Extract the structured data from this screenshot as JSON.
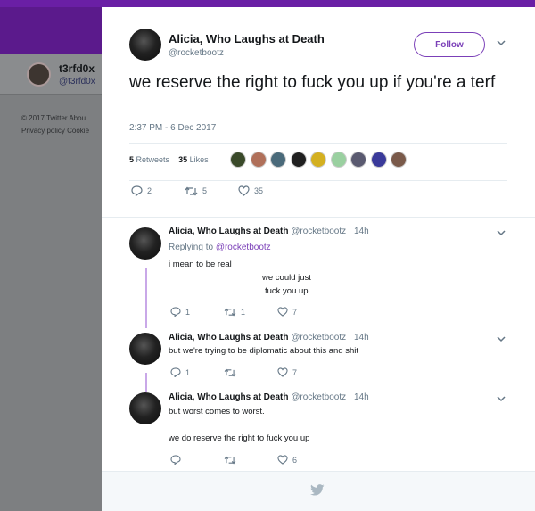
{
  "background": {
    "profile": {
      "name": "t3rfd0x",
      "handle": "@t3rfd0x"
    },
    "footer": {
      "line1": "© 2017 Twitter  Abou",
      "line2": "Privacy policy  Cookie"
    }
  },
  "tweet": {
    "author_name": "Alicia, Who Laughs at Death",
    "author_handle": "@rocketbootz",
    "follow_label": "Follow",
    "text": "we reserve the right to fuck you up if you're a terf",
    "timestamp": "2:37 PM - 6 Dec 2017",
    "retweets_count": "5",
    "retweets_label": "Retweets",
    "likes_count": "35",
    "likes_label": "Likes",
    "actions": {
      "replies": "2",
      "retweets": "5",
      "likes": "35"
    }
  },
  "replies": [
    {
      "name": "Alicia, Who Laughs at Death",
      "handle_time": "@rocketbootz · 14h",
      "replying_prefix": "Replying to",
      "replying_to": "@rocketbootz",
      "line1": "i mean to be real",
      "line2": "we could just",
      "line3": "fuck you up",
      "replies": "1",
      "retweets": "1",
      "likes": "7"
    },
    {
      "name": "Alicia, Who Laughs at Death",
      "handle_time": "@rocketbootz · 14h",
      "line1": "but we're trying to be diplomatic about this and shit",
      "replies": "1",
      "retweets": "",
      "likes": "7"
    },
    {
      "name": "Alicia, Who Laughs at Death",
      "handle_time": "@rocketbootz · 14h",
      "line1": "but worst comes to worst.",
      "line2": "we do reserve the right to fuck you up",
      "replies": "",
      "retweets": "",
      "likes": "6"
    }
  ],
  "colors": {
    "accent": "#7b40b8",
    "header": "#5b1a8c",
    "overlay": "#7d7f81",
    "thread": "#c9a8e8"
  },
  "icons": [
    "reply-icon",
    "retweet-icon",
    "like-icon",
    "chevron-down-icon",
    "twitter-bird-icon"
  ]
}
